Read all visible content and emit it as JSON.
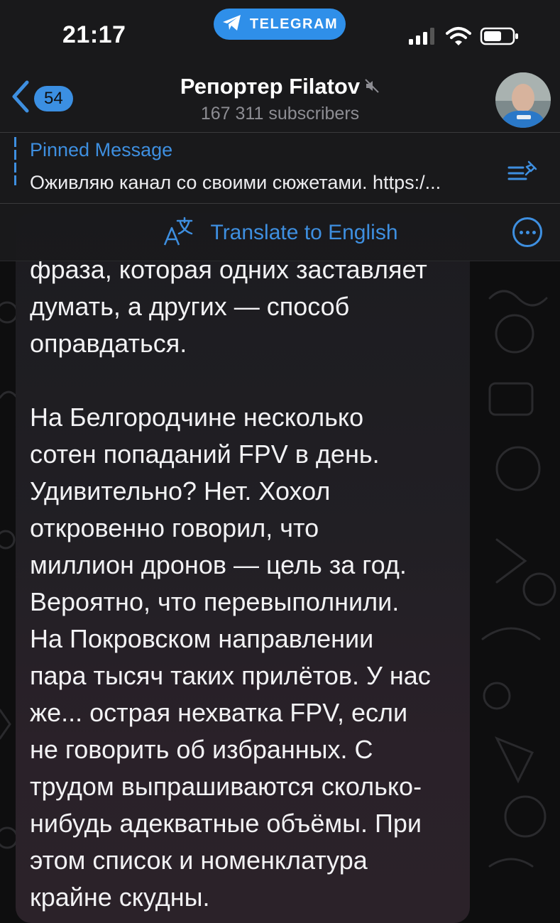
{
  "status_bar": {
    "time": "21:17",
    "app_pill": "TELEGRAM"
  },
  "header": {
    "back_count": "54",
    "channel_title": "Репортер Filatov",
    "subscribers": "167 311 subscribers"
  },
  "pinned": {
    "label": "Pinned Message",
    "text": "Оживляю канал со своими сюжетами. https:/..."
  },
  "translate_bar": {
    "label": "Translate to English"
  },
  "message": {
    "text": "фраза, которая одних заставляет\nдумать, а других — способ\nоправдаться.\n\nНа Белгородчине несколько\nсотен попаданий FPV в день.\nУдивительно? Нет. Хохол\nоткровенно говорил, что\nмиллион дронов — цель за год.\nВероятно, что перевыполнили.\nНа Покровском направлении\nпара тысяч таких прилётов. У нас\nже... острая нехватка FPV, если\nне говорить об избранных. С\nтрудом выпрашиваются сколько-\nнибудь адекватные объёмы. При\nэтом список и номенклатура\nкрайне скудны."
  },
  "colors": {
    "accent": "#3e8fe0",
    "pill": "#2f8fe9",
    "header_bg": "#1a1a1c"
  },
  "icons": {
    "back": "chevron-left-icon",
    "mute": "muted-speaker-icon",
    "pin": "pin-list-icon",
    "translate": "translate-icon",
    "more": "ellipsis-circle-icon"
  }
}
